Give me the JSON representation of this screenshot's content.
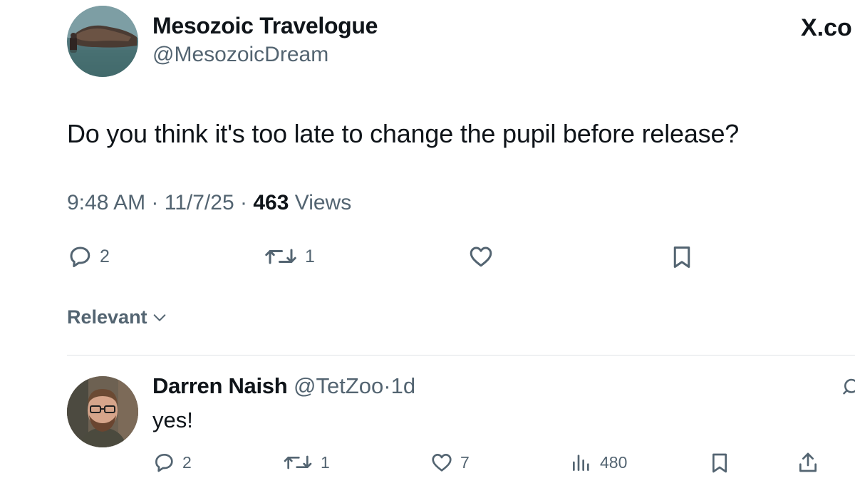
{
  "tweet": {
    "author_name": "Mesozoic Travelogue",
    "author_handle": "@MesozoicDream",
    "watermark": "X.co",
    "text": "Do you think it's too late to change the pupil before release?",
    "time": "9:48 AM",
    "date": "11/7/25",
    "separator": "·",
    "views_count": "463",
    "views_label": "Views",
    "actions": {
      "replies": "2",
      "reposts": "1"
    },
    "icons": [
      "reply-icon",
      "repost-icon",
      "like-icon",
      "bookmark-icon"
    ]
  },
  "sort": {
    "label": "Relevant"
  },
  "reply": {
    "author_name": "Darren Naish",
    "author_handle": "@TetZoo",
    "separator": "·",
    "age": "1d",
    "text": "yes!",
    "actions": {
      "replies": "2",
      "reposts": "1",
      "likes": "7",
      "views": "480"
    },
    "icons": [
      "reply-icon",
      "repost-icon",
      "like-icon",
      "views-icon",
      "bookmark-icon",
      "share-icon"
    ]
  },
  "colors": {
    "text_primary": "#0f1419",
    "text_secondary": "#536471",
    "divider": "#dfe3e6",
    "background": "#ffffff"
  }
}
